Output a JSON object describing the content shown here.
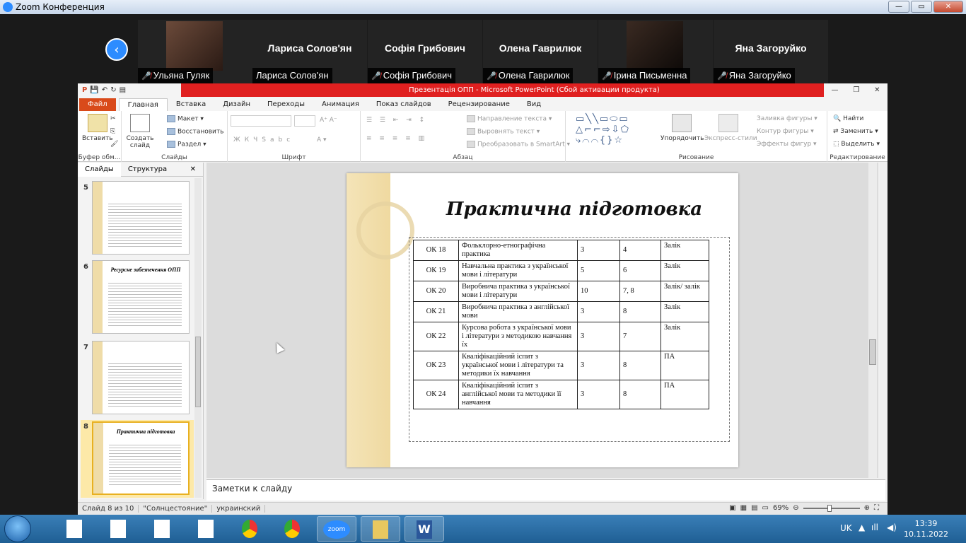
{
  "zoom": {
    "title": "Zoom Конференция",
    "window_buttons": [
      "—",
      "▭",
      "✕"
    ],
    "participants": [
      {
        "display": "",
        "name": "Ульяна Гуляк",
        "video": true
      },
      {
        "display": "Лариса Солов'ян",
        "name": "Лариса Солов'ян",
        "video": false
      },
      {
        "display": "Софія Грибович",
        "name": "Софія Грибович",
        "video": false
      },
      {
        "display": "Олена Гаврилюк",
        "name": "Олена Гаврилюк",
        "video": false
      },
      {
        "display": "",
        "name": "Ірина Письменна",
        "video": true
      },
      {
        "display": "Яна Загоруйко",
        "name": "Яна Загоруйко",
        "video": false
      }
    ]
  },
  "ppt": {
    "title": "Презентація ОПП  -  Microsoft PowerPoint (Сбой активации продукта)",
    "tabs": [
      "Файл",
      "Главная",
      "Вставка",
      "Дизайн",
      "Переходы",
      "Анимация",
      "Показ слайдов",
      "Рецензирование",
      "Вид"
    ],
    "ribbon": {
      "clipboard": {
        "paste": "Вставить",
        "label": "Буфер обм..."
      },
      "slides": {
        "new_slide": "Создать слайд",
        "layout": "Макет",
        "reset": "Восстановить",
        "section": "Раздел",
        "label": "Слайды"
      },
      "font": {
        "label": "Шрифт"
      },
      "paragraph": {
        "text_dir": "Направление текста",
        "align_text": "Выровнять текст",
        "smartart": "Преобразовать в SmartArt",
        "label": "Абзац"
      },
      "drawing": {
        "arrange": "Упорядочить",
        "quick_styles": "Экспресс-стили",
        "fill": "Заливка фигуры",
        "outline": "Контур фигуры",
        "effects": "Эффекты фигур",
        "label": "Рисование"
      },
      "editing": {
        "find": "Найти",
        "replace": "Заменить",
        "select": "Выделить",
        "label": "Редактирование"
      }
    },
    "panel_tabs": [
      "Слайды",
      "Структура"
    ],
    "thumbnails": [
      {
        "num": "5",
        "title": "",
        "selected": false
      },
      {
        "num": "6",
        "title": "Ресурсне забезпечення ОПП",
        "selected": false
      },
      {
        "num": "7",
        "title": "",
        "selected": false
      },
      {
        "num": "8",
        "title": "Практична підготовка",
        "selected": true
      }
    ],
    "slide": {
      "title": "Практична підготовка",
      "rows": [
        [
          "ОК 18",
          "Фольклорно-етнографічна практика",
          "3",
          "4",
          "Залік"
        ],
        [
          "ОК 19",
          "Навчальна практика з української мови і літератури",
          "5",
          "6",
          "Залік"
        ],
        [
          "ОК 20",
          "Виробнича практика з української мови і літератури",
          "10",
          "7, 8",
          "Залік/ залік"
        ],
        [
          "ОК 21",
          "Виробнича практика з англійської мови",
          "3",
          "8",
          "Залік"
        ],
        [
          "ОК 22",
          "Курсова робота з української мови і літератури з методикою навчання їх",
          "3",
          "7",
          "Залік"
        ],
        [
          "ОК 23",
          "Кваліфікаційний іспит з української мови і літератури та методики їх навчання",
          "3",
          "8",
          "ПА"
        ],
        [
          "ОК 24",
          "Кваліфікаційний іспит з англійської мови та методики її навчання",
          "3",
          "8",
          "ПА"
        ]
      ]
    },
    "notes_placeholder": "Заметки к слайду",
    "status": {
      "slide": "Слайд 8 из 10",
      "theme": "\"Солнцестояние\"",
      "lang": "украинский",
      "zoom": "69%"
    }
  },
  "taskbar": {
    "lang": "UK",
    "time": "13:39",
    "date": "10.11.2022"
  }
}
